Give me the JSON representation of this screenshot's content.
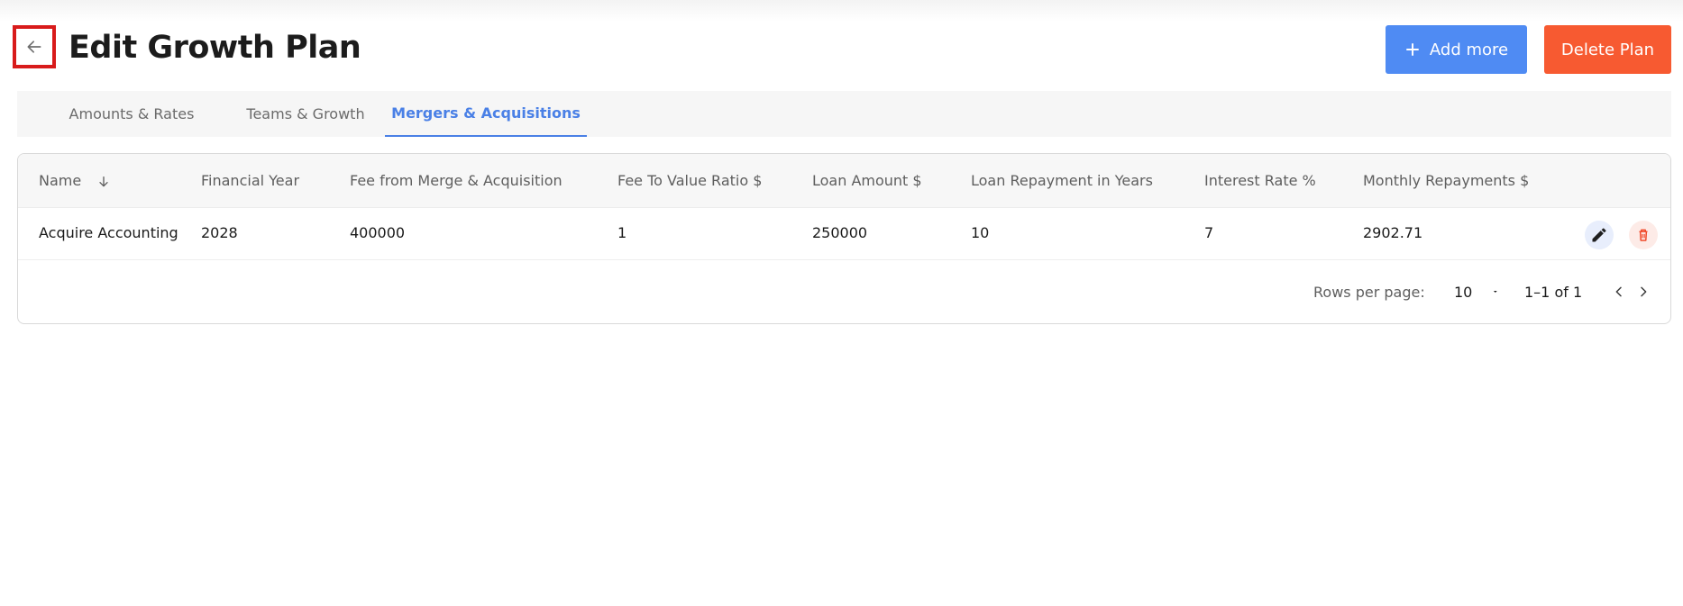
{
  "header": {
    "title": "Edit Growth Plan",
    "add_label": "Add more",
    "delete_label": "Delete Plan"
  },
  "tabs": [
    {
      "label": "Amounts & Rates",
      "active": false
    },
    {
      "label": "Teams & Growth",
      "active": false
    },
    {
      "label": "Mergers & Acquisitions",
      "active": true
    }
  ],
  "table": {
    "columns": [
      "Name",
      "Financial Year",
      "Fee from Merge & Acquisition",
      "Fee To Value Ratio $",
      "Loan Amount $",
      "Loan Repayment in Years",
      "Interest Rate %",
      "Monthly Repayments $"
    ],
    "rows": [
      [
        "Acquire Accounting",
        "2028",
        "400000",
        "1",
        "250000",
        "10",
        "7",
        "2902.71"
      ]
    ]
  },
  "pagination": {
    "rows_per_page_label": "Rows per page:",
    "rows_per_page_value": "10",
    "range": "1–1 of 1"
  },
  "colors": {
    "primary": "#4f8bf3",
    "danger": "#f75a31",
    "active_tab": "#4a80e6",
    "highlight_border": "#d81b1b"
  },
  "icons": {
    "back": "arrow-left-icon",
    "add": "plus-icon",
    "sort": "arrow-down-icon",
    "edit": "pencil-icon",
    "delete": "trash-icon",
    "select": "caret-down-icon",
    "prev": "chevron-left-icon",
    "next": "chevron-right-icon"
  }
}
